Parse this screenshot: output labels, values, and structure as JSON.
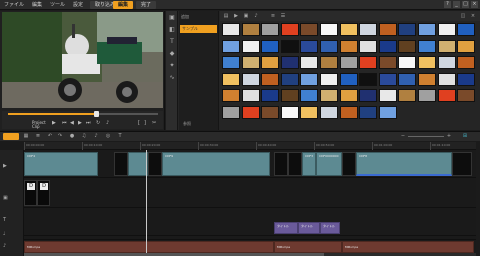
{
  "menu": [
    "ファイル",
    "編集",
    "ツール",
    "設定"
  ],
  "steps": {
    "capture": "取り込み",
    "edit": "編集",
    "share": "完了"
  },
  "window_buttons": [
    "?",
    "_",
    "□",
    "×"
  ],
  "player": {
    "project_label": "Project",
    "clip_label": "Clip"
  },
  "library": {
    "folder_header": "追加",
    "folder_item": "サンプル",
    "add_label": "参照"
  },
  "timeline": {
    "ruler_ticks": [
      "00:00:00:00",
      "00:00:10:00",
      "00:00:20:00",
      "00:00:30:00",
      "00:00:40:00",
      "00:00:50:00",
      "00:01:00:00",
      "00:01:10:00"
    ],
    "video_clips": [
      {
        "label": "CDF4",
        "kind": "video"
      },
      {
        "label": "",
        "kind": "dark"
      },
      {
        "label": "",
        "kind": "video"
      },
      {
        "label": "",
        "kind": "dark"
      },
      {
        "label": "CDF9",
        "kind": "video"
      },
      {
        "label": "",
        "kind": "dark"
      },
      {
        "label": "",
        "kind": "dark"
      },
      {
        "label": "CDF3",
        "kind": "video"
      },
      {
        "label": "CDF0000000",
        "kind": "video"
      },
      {
        "label": "",
        "kind": "dark"
      },
      {
        "label": "CDF8",
        "kind": "video"
      },
      {
        "label": "",
        "kind": "dark"
      }
    ],
    "overlay_clips": [
      "D",
      "D"
    ],
    "title_clips": [
      "タイトル",
      "タイトル",
      "タイトル"
    ],
    "music_clips": [
      "MIR.mpa",
      "MIR.mpa",
      "MIR.mpa"
    ]
  },
  "accent_color": "#f0a020"
}
